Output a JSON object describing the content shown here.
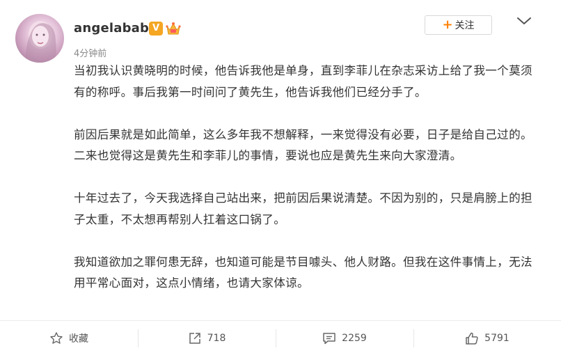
{
  "user": {
    "name": "angelababy",
    "verified_label": "V",
    "post_time": "4分钟前"
  },
  "header": {
    "follow_label": "关注"
  },
  "content": {
    "paragraphs": [
      "当初我认识黄晓明的时候，他告诉我他是单身，直到李菲儿在杂志采访上给了我一个莫须有的称呼。事后我第一时间问了黄先生，他告诉我他们已经分手了。",
      "前因后果就是如此简单，这么多年我不想解释，一来觉得没有必要，日子是给自己过的。二来也觉得这是黄先生和李菲儿的事情，要说也应是黄先生来向大家澄清。",
      "十年过去了，今天我选择自己站出来，把前因后果说清楚。不因为别的，只是肩膀上的担子太重，不太想再帮别人扛着这口锅了。",
      "我知道欲加之罪何患无辞，也知道可能是节目噱头、他人财路。但我在这件事情上，无法用平常心面对，这点小情绪，也请大家体谅。"
    ]
  },
  "footer": {
    "favorite_label": "收藏",
    "repost_count": "718",
    "comment_count": "2259",
    "like_count": "5791"
  },
  "colors": {
    "accent": "#ff8200",
    "verified_badge": "#f5a623",
    "text": "#333333",
    "muted": "#8a8a8a"
  },
  "icons": {
    "favorite": "star-icon",
    "repost": "share-icon",
    "comment": "comment-icon",
    "like": "thumbs-up-icon",
    "more": "chevron-down-icon",
    "crown": "crown-badge-icon"
  }
}
